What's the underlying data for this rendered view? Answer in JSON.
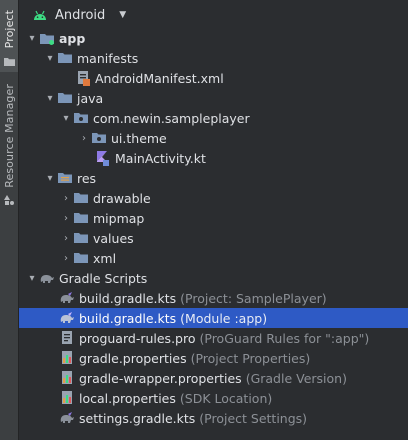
{
  "side_tabs": {
    "project": "Project",
    "resource_manager": "Resource Manager"
  },
  "header": {
    "title": "Android"
  },
  "tree": {
    "app": "app",
    "manifests": "manifests",
    "android_manifest": "AndroidManifest.xml",
    "java": "java",
    "package": "com.newin.sampleplayer",
    "ui_theme": "ui.theme",
    "main_activity": "MainActivity.kt",
    "res": "res",
    "drawable": "drawable",
    "mipmap": "mipmap",
    "values": "values",
    "xml": "xml",
    "gradle_scripts": "Gradle Scripts",
    "gradle_files": [
      {
        "name": "build.gradle.kts",
        "hint": "(Project: SamplePlayer)"
      },
      {
        "name": "build.gradle.kts",
        "hint": "(Module :app)"
      },
      {
        "name": "proguard-rules.pro",
        "hint": "(ProGuard Rules for \":app\")"
      },
      {
        "name": "gradle.properties",
        "hint": "(Project Properties)"
      },
      {
        "name": "gradle-wrapper.properties",
        "hint": "(Gradle Version)"
      },
      {
        "name": "local.properties",
        "hint": "(SDK Location)"
      },
      {
        "name": "settings.gradle.kts",
        "hint": "(Project Settings)"
      }
    ]
  },
  "colors": {
    "background": "#2b2d30",
    "selection": "#2e5ac5",
    "folder": "#7c96b8",
    "android_green": "#3ddc84",
    "kotlin_purple": "#8e7ae6"
  },
  "icons": [
    "android-icon",
    "folder-icon",
    "module-folder-icon",
    "package-icon",
    "manifest-file-icon",
    "kotlin-file-icon",
    "res-folder-icon",
    "gradle-elephant-icon",
    "gradle-file-icon",
    "properties-file-icon",
    "proguard-file-icon"
  ]
}
